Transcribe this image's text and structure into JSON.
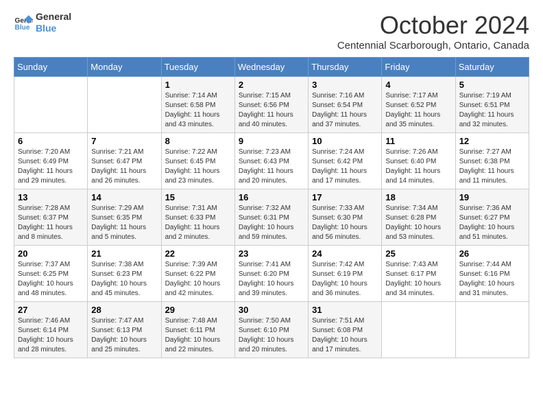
{
  "logo": {
    "line1": "General",
    "line2": "Blue"
  },
  "title": "October 2024",
  "location": "Centennial Scarborough, Ontario, Canada",
  "days_header": [
    "Sunday",
    "Monday",
    "Tuesday",
    "Wednesday",
    "Thursday",
    "Friday",
    "Saturday"
  ],
  "weeks": [
    [
      {
        "day": "",
        "info": ""
      },
      {
        "day": "",
        "info": ""
      },
      {
        "day": "1",
        "info": "Sunrise: 7:14 AM\nSunset: 6:58 PM\nDaylight: 11 hours and 43 minutes."
      },
      {
        "day": "2",
        "info": "Sunrise: 7:15 AM\nSunset: 6:56 PM\nDaylight: 11 hours and 40 minutes."
      },
      {
        "day": "3",
        "info": "Sunrise: 7:16 AM\nSunset: 6:54 PM\nDaylight: 11 hours and 37 minutes."
      },
      {
        "day": "4",
        "info": "Sunrise: 7:17 AM\nSunset: 6:52 PM\nDaylight: 11 hours and 35 minutes."
      },
      {
        "day": "5",
        "info": "Sunrise: 7:19 AM\nSunset: 6:51 PM\nDaylight: 11 hours and 32 minutes."
      }
    ],
    [
      {
        "day": "6",
        "info": "Sunrise: 7:20 AM\nSunset: 6:49 PM\nDaylight: 11 hours and 29 minutes."
      },
      {
        "day": "7",
        "info": "Sunrise: 7:21 AM\nSunset: 6:47 PM\nDaylight: 11 hours and 26 minutes."
      },
      {
        "day": "8",
        "info": "Sunrise: 7:22 AM\nSunset: 6:45 PM\nDaylight: 11 hours and 23 minutes."
      },
      {
        "day": "9",
        "info": "Sunrise: 7:23 AM\nSunset: 6:43 PM\nDaylight: 11 hours and 20 minutes."
      },
      {
        "day": "10",
        "info": "Sunrise: 7:24 AM\nSunset: 6:42 PM\nDaylight: 11 hours and 17 minutes."
      },
      {
        "day": "11",
        "info": "Sunrise: 7:26 AM\nSunset: 6:40 PM\nDaylight: 11 hours and 14 minutes."
      },
      {
        "day": "12",
        "info": "Sunrise: 7:27 AM\nSunset: 6:38 PM\nDaylight: 11 hours and 11 minutes."
      }
    ],
    [
      {
        "day": "13",
        "info": "Sunrise: 7:28 AM\nSunset: 6:37 PM\nDaylight: 11 hours and 8 minutes."
      },
      {
        "day": "14",
        "info": "Sunrise: 7:29 AM\nSunset: 6:35 PM\nDaylight: 11 hours and 5 minutes."
      },
      {
        "day": "15",
        "info": "Sunrise: 7:31 AM\nSunset: 6:33 PM\nDaylight: 11 hours and 2 minutes."
      },
      {
        "day": "16",
        "info": "Sunrise: 7:32 AM\nSunset: 6:31 PM\nDaylight: 10 hours and 59 minutes."
      },
      {
        "day": "17",
        "info": "Sunrise: 7:33 AM\nSunset: 6:30 PM\nDaylight: 10 hours and 56 minutes."
      },
      {
        "day": "18",
        "info": "Sunrise: 7:34 AM\nSunset: 6:28 PM\nDaylight: 10 hours and 53 minutes."
      },
      {
        "day": "19",
        "info": "Sunrise: 7:36 AM\nSunset: 6:27 PM\nDaylight: 10 hours and 51 minutes."
      }
    ],
    [
      {
        "day": "20",
        "info": "Sunrise: 7:37 AM\nSunset: 6:25 PM\nDaylight: 10 hours and 48 minutes."
      },
      {
        "day": "21",
        "info": "Sunrise: 7:38 AM\nSunset: 6:23 PM\nDaylight: 10 hours and 45 minutes."
      },
      {
        "day": "22",
        "info": "Sunrise: 7:39 AM\nSunset: 6:22 PM\nDaylight: 10 hours and 42 minutes."
      },
      {
        "day": "23",
        "info": "Sunrise: 7:41 AM\nSunset: 6:20 PM\nDaylight: 10 hours and 39 minutes."
      },
      {
        "day": "24",
        "info": "Sunrise: 7:42 AM\nSunset: 6:19 PM\nDaylight: 10 hours and 36 minutes."
      },
      {
        "day": "25",
        "info": "Sunrise: 7:43 AM\nSunset: 6:17 PM\nDaylight: 10 hours and 34 minutes."
      },
      {
        "day": "26",
        "info": "Sunrise: 7:44 AM\nSunset: 6:16 PM\nDaylight: 10 hours and 31 minutes."
      }
    ],
    [
      {
        "day": "27",
        "info": "Sunrise: 7:46 AM\nSunset: 6:14 PM\nDaylight: 10 hours and 28 minutes."
      },
      {
        "day": "28",
        "info": "Sunrise: 7:47 AM\nSunset: 6:13 PM\nDaylight: 10 hours and 25 minutes."
      },
      {
        "day": "29",
        "info": "Sunrise: 7:48 AM\nSunset: 6:11 PM\nDaylight: 10 hours and 22 minutes."
      },
      {
        "day": "30",
        "info": "Sunrise: 7:50 AM\nSunset: 6:10 PM\nDaylight: 10 hours and 20 minutes."
      },
      {
        "day": "31",
        "info": "Sunrise: 7:51 AM\nSunset: 6:08 PM\nDaylight: 10 hours and 17 minutes."
      },
      {
        "day": "",
        "info": ""
      },
      {
        "day": "",
        "info": ""
      }
    ]
  ]
}
